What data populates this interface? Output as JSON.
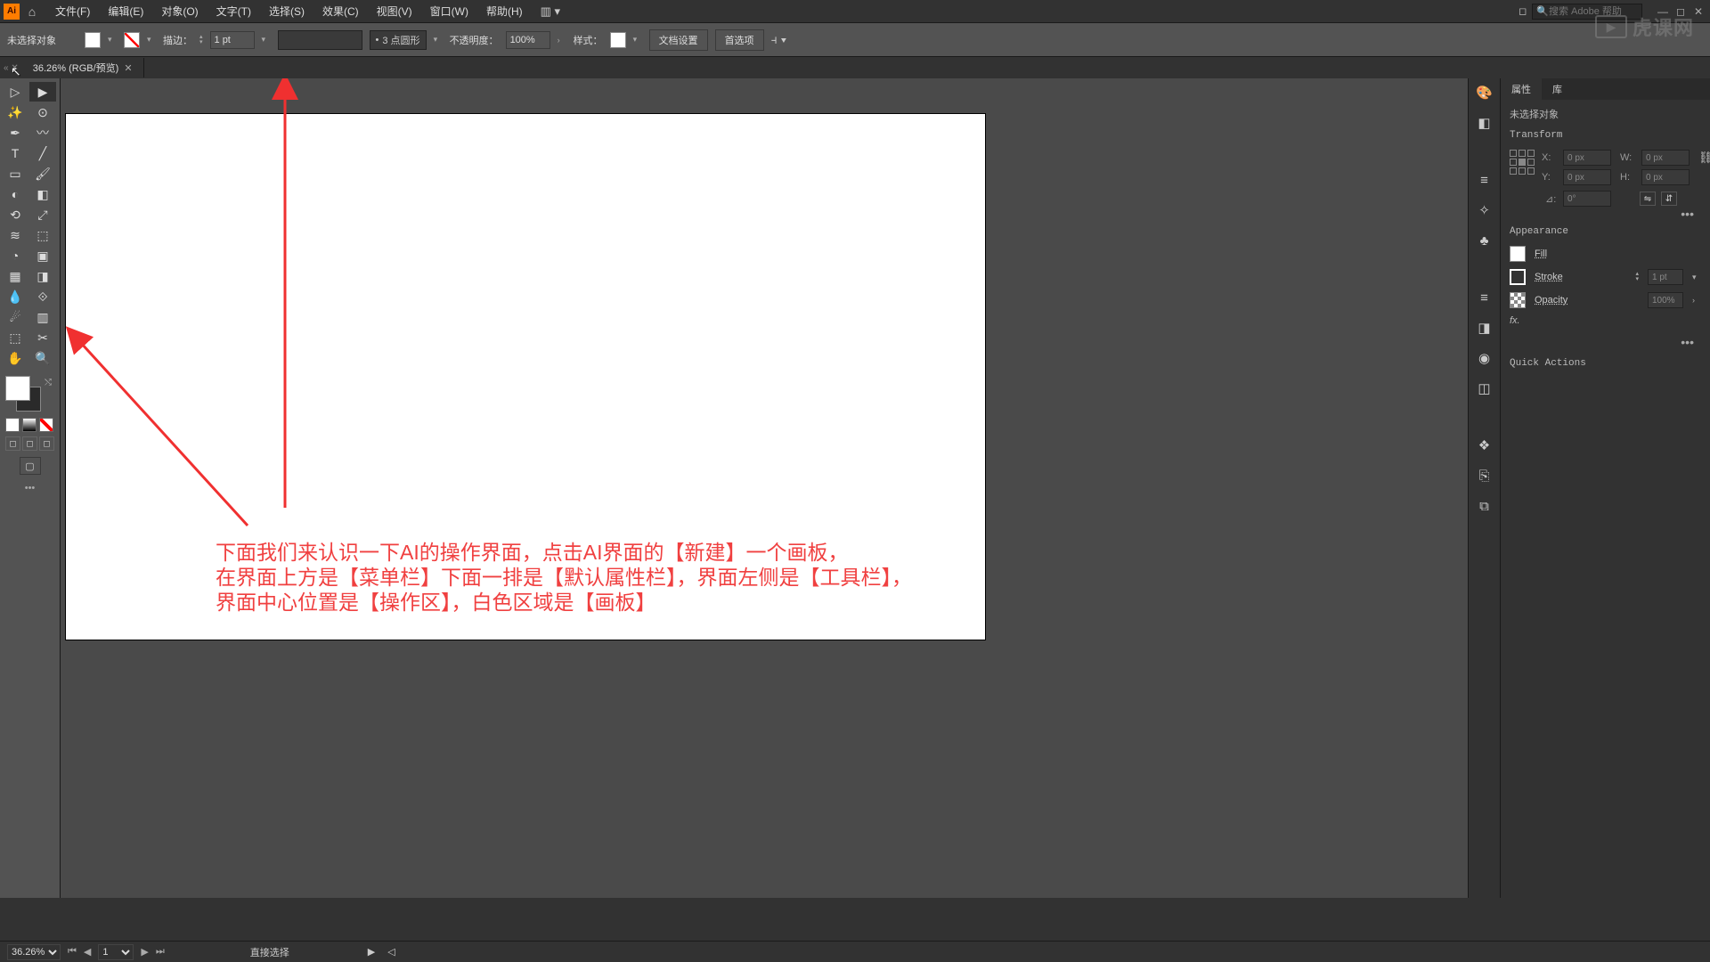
{
  "app": {
    "icon_label": "Ai"
  },
  "menu": {
    "file": "文件(F)",
    "edit": "编辑(E)",
    "object": "对象(O)",
    "type": "文字(T)",
    "select": "选择(S)",
    "effect": "效果(C)",
    "view": "视图(V)",
    "window": "窗口(W)",
    "help": "帮助(H)"
  },
  "search": {
    "placeholder": "搜索 Adobe 帮助"
  },
  "control": {
    "no_selection": "未选择对象",
    "stroke_label": "描边：",
    "stroke_value": "1 pt",
    "brush_label": "3 点圆形",
    "opacity_label": "不透明度：",
    "opacity_value": "100%",
    "style_label": "样式：",
    "doc_setup": "文档设置",
    "prefs": "首选项"
  },
  "tabs": {
    "doc_title": "36.26% (RGB/预览)"
  },
  "annotation": {
    "line1": "下面我们来认识一下AI的操作界面，点击AI界面的【新建】一个画板，",
    "line2": "在界面上方是【菜单栏】下面一排是【默认属性栏】，界面左侧是【工具栏】，",
    "line3": "界面中心位置是【操作区】，白色区域是【画板】"
  },
  "properties": {
    "tab_props": "属性",
    "tab_lib": "库",
    "no_selection": "未选择对象",
    "transform_title": "Transform",
    "x_label": "X:",
    "x_value": "0 px",
    "y_label": "Y:",
    "y_value": "0 px",
    "w_label": "W:",
    "w_value": "0 px",
    "h_label": "H:",
    "h_value": "0 px",
    "angle_label": "⊿:",
    "angle_value": "0°",
    "appearance_title": "Appearance",
    "fill_label": "Fill",
    "stroke_label": "Stroke",
    "stroke_value": "1 pt",
    "opacity_label": "Opacity",
    "opacity_value": "100%",
    "fx_label": "fx.",
    "quick_actions": "Quick Actions"
  },
  "status": {
    "zoom": "36.26%",
    "artboard": "1",
    "tool_name": "直接选择"
  },
  "watermark": {
    "text": "虎课网"
  }
}
